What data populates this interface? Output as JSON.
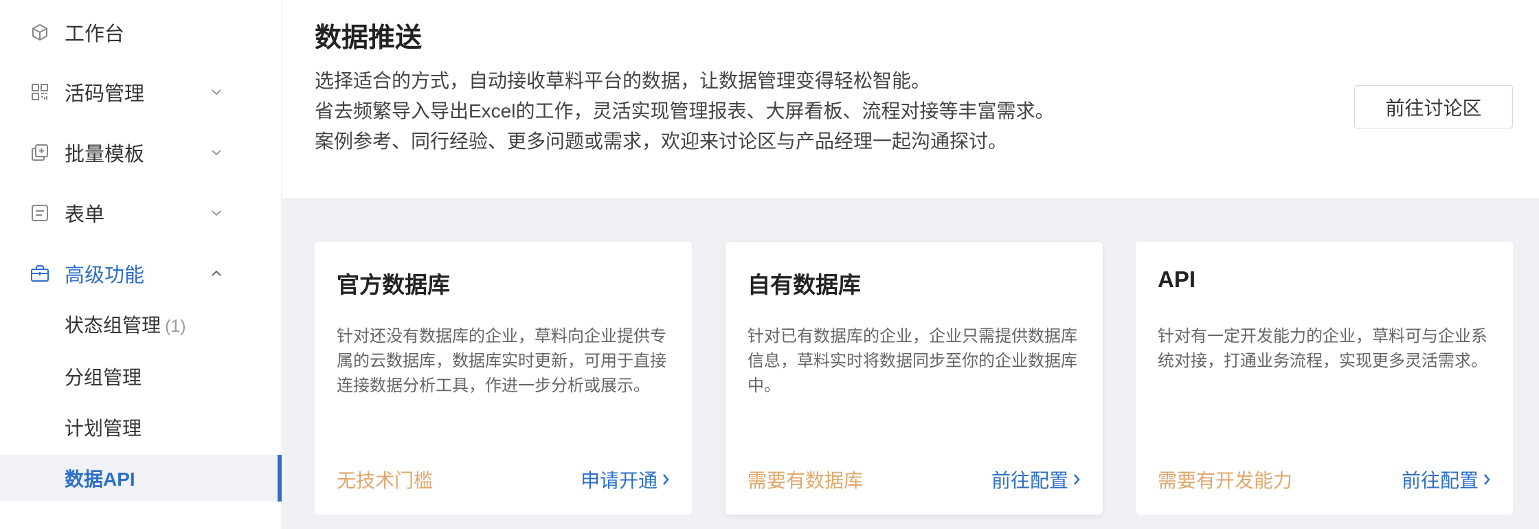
{
  "sidebar": {
    "items": [
      {
        "label": "工作台",
        "icon": "cube-icon"
      },
      {
        "label": "活码管理",
        "icon": "qrcode-grid-icon"
      },
      {
        "label": "批量模板",
        "icon": "copy-template-icon"
      },
      {
        "label": "表单",
        "icon": "form-list-icon"
      },
      {
        "label": "高级功能",
        "icon": "briefcase-icon"
      }
    ],
    "sub_items": [
      {
        "label": "状态组管理",
        "count": "(1)"
      },
      {
        "label": "分组管理"
      },
      {
        "label": "计划管理"
      },
      {
        "label": "数据API"
      }
    ]
  },
  "header": {
    "title": "数据推送",
    "desc_lines": [
      "选择适合的方式，自动接收草料平台的数据，让数据管理变得轻松智能。",
      "省去频繁导入导出Excel的工作，灵活实现管理报表、大屏看板、流程对接等丰富需求。",
      "案例参考、同行经验、更多问题或需求，欢迎来讨论区与产品经理一起沟通探讨。"
    ],
    "forum_button": "前往讨论区"
  },
  "cards": [
    {
      "title": "官方数据库",
      "desc": "针对还没有数据库的企业，草料向企业提供专属的云数据库，数据库实时更新，可用于直接连接数据分析工具，作进一步分析或展示。",
      "tag": "无技术门槛",
      "link": "申请开通"
    },
    {
      "title": "自有数据库",
      "desc": "针对已有数据库的企业，企业只需提供数据库信息，草料实时将数据同步至你的企业数据库中。",
      "tag": "需要有数据库",
      "link": "前往配置"
    },
    {
      "title": "API",
      "desc": "针对有一定开发能力的企业，草料可与企业系统对接，打通业务流程，实现更多灵活需求。",
      "tag": "需要有开发能力",
      "link": "前往配置"
    }
  ],
  "colors": {
    "accent": "#2e6fc7",
    "tag": "#e0a86a",
    "background": "#f0f1f5"
  }
}
